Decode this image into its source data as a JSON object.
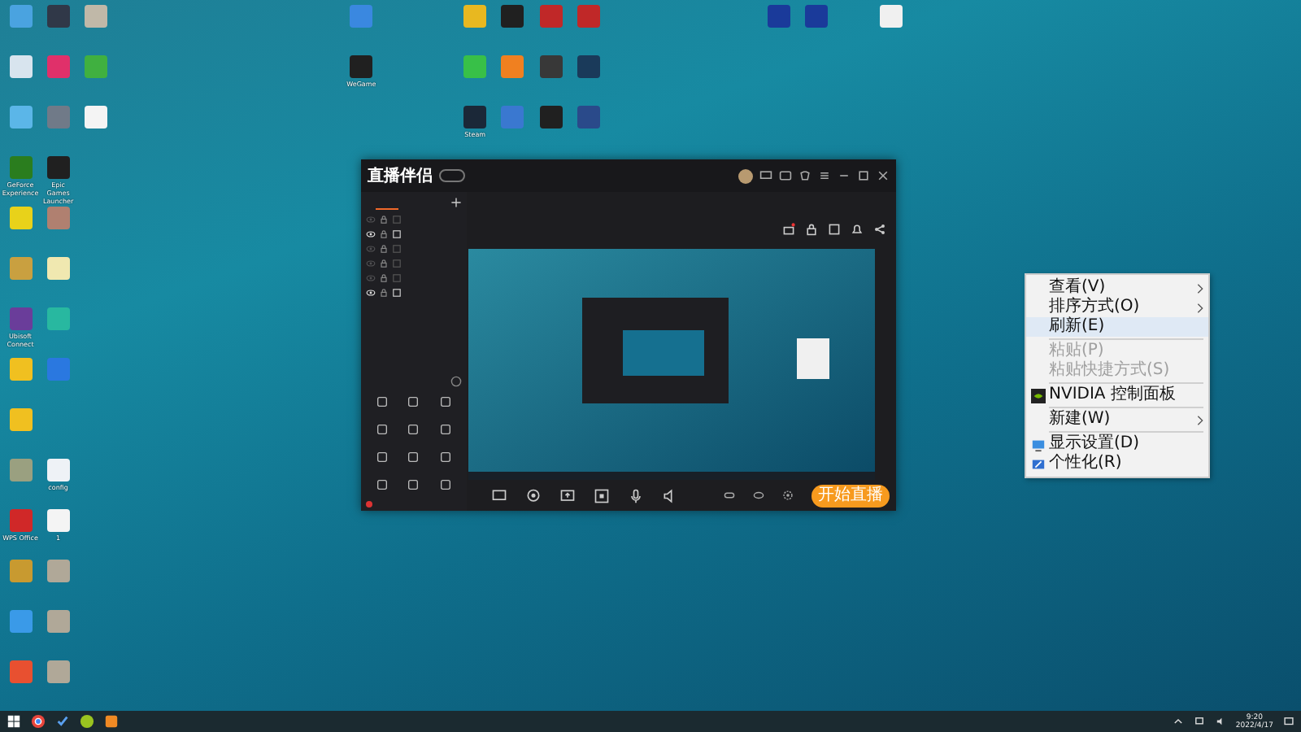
{
  "desktop_columns": [
    [
      {
        "color": "#4aa3e0"
      },
      {
        "color": "#d8e4ee"
      },
      {
        "color": "#5bb6e8"
      },
      {
        "color": "#2a7d1e",
        "label": "GeForce Experience"
      },
      {
        "color": "#e8d21a"
      },
      {
        "color": "#c9a040"
      },
      {
        "color": "#6a3d9a",
        "label": "Ubisoft Connect"
      },
      {
        "color": "#f0c020"
      },
      {
        "color": "#f0c020"
      },
      {
        "color": "#9aa080"
      },
      {
        "color": "#d02828",
        "label": "WPS Office"
      },
      {
        "color": "#c89a30"
      },
      {
        "color": "#3a9ae8"
      },
      {
        "color": "#e85030"
      }
    ],
    [
      {
        "color": "#303848"
      },
      {
        "color": "#e0306a"
      },
      {
        "color": "#707a88"
      },
      {
        "color": "#202020",
        "label": "Epic Games Launcher"
      },
      {
        "color": "#b08070"
      },
      {
        "color": "#f0e8b0"
      },
      {
        "color": "#28b8a0"
      },
      {
        "color": "#2a78e0"
      },
      null,
      {
        "color": "#eef2f6",
        "label": "config"
      },
      {
        "color": "#f4f4f4",
        "label": "1"
      },
      {
        "color": "#b0a898"
      },
      {
        "color": "#b0a898"
      },
      {
        "color": "#b0a898"
      }
    ],
    [
      {
        "color": "#c0b8a8"
      },
      {
        "color": "#40b040"
      },
      {
        "color": "#f4f4f4"
      }
    ],
    [],
    [],
    [],
    [],
    [],
    [],
    [
      {
        "color": "#3a88e0"
      },
      {
        "color": "#202020",
        "label": "WeGame"
      }
    ],
    [],
    [],
    [
      {
        "color": "#e8b820"
      },
      {
        "color": "#38c048"
      },
      {
        "color": "#1b2838",
        "label": "Steam"
      }
    ],
    [
      {
        "color": "#202020"
      },
      {
        "color": "#f08020"
      },
      {
        "color": "#3a78d0"
      }
    ],
    [
      {
        "color": "#c02828"
      },
      {
        "color": "#383838"
      },
      {
        "color": "#202020"
      }
    ],
    [
      {
        "color": "#c02828"
      },
      {
        "color": "#1a3a5a"
      },
      {
        "color": "#2a4a8a"
      }
    ],
    [],
    [],
    [],
    [],
    [
      {
        "color": "#1a3a9a"
      }
    ],
    [
      {
        "color": "#1a3a9a"
      }
    ],
    [],
    [
      {
        "color": "#f0f0f0"
      }
    ]
  ],
  "app": {
    "logo": "直播伴侣",
    "scenes": [
      {
        "visible": false
      },
      {
        "visible": true
      },
      {
        "visible": false
      },
      {
        "visible": false
      },
      {
        "visible": false
      },
      {
        "visible": true
      }
    ],
    "start_button": "开始直播"
  },
  "context_menu": [
    {
      "kind": "item",
      "label": "查看(V)",
      "submenu": true,
      "disabled": false,
      "selected": false
    },
    {
      "kind": "item",
      "label": "排序方式(O)",
      "submenu": true,
      "disabled": false,
      "selected": false
    },
    {
      "kind": "item",
      "label": "刷新(E)",
      "submenu": false,
      "disabled": false,
      "selected": true
    },
    {
      "kind": "separator"
    },
    {
      "kind": "item",
      "label": "粘贴(P)",
      "submenu": false,
      "disabled": true,
      "selected": false
    },
    {
      "kind": "item",
      "label": "粘贴快捷方式(S)",
      "submenu": false,
      "disabled": true,
      "selected": false
    },
    {
      "kind": "separator"
    },
    {
      "kind": "item",
      "label": "NVIDIA 控制面板",
      "submenu": false,
      "disabled": false,
      "selected": false
    },
    {
      "kind": "separator"
    },
    {
      "kind": "item",
      "label": "新建(W)",
      "submenu": true,
      "disabled": false,
      "selected": false
    },
    {
      "kind": "separator"
    },
    {
      "kind": "item",
      "label": "显示设置(D)",
      "submenu": false,
      "disabled": false,
      "selected": false
    },
    {
      "kind": "item",
      "label": "个性化(R)",
      "submenu": false,
      "disabled": false,
      "selected": false
    }
  ],
  "taskbar": {
    "time": "9:20",
    "date": "2022/4/17"
  }
}
